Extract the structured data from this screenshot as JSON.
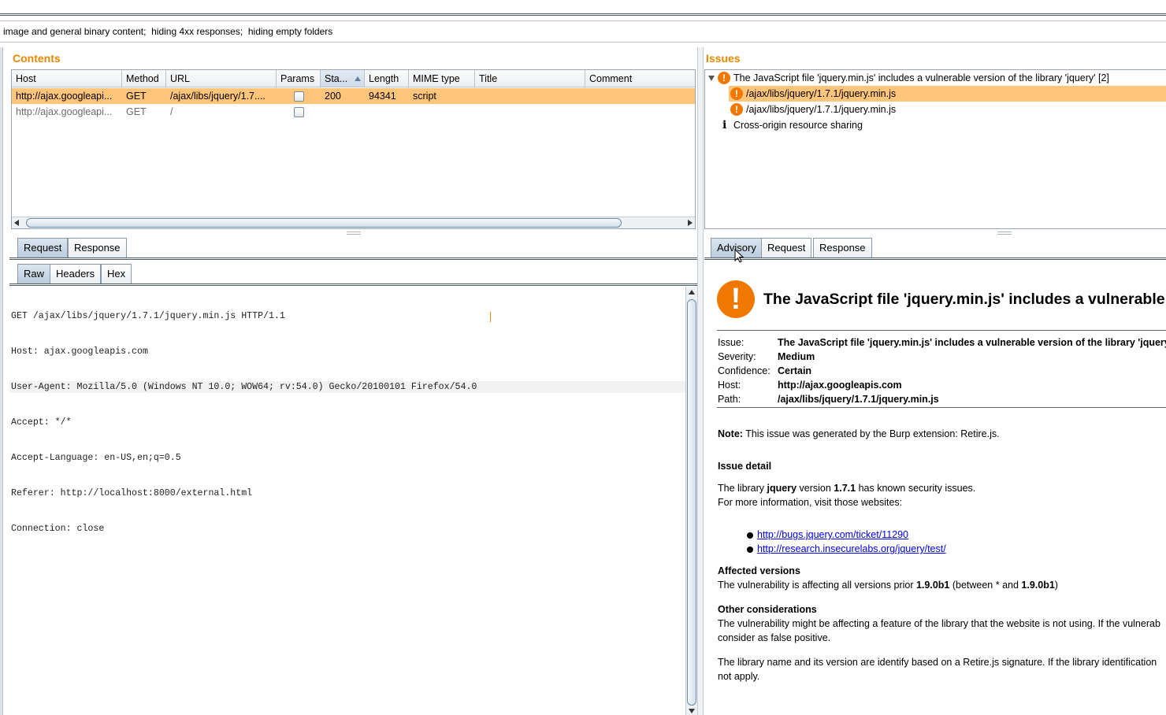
{
  "filter": {
    "text": "image and general binary content;  hiding 4xx responses;  hiding empty folders"
  },
  "contents": {
    "title": "Contents",
    "columns": [
      "Host",
      "Method",
      "URL",
      "Params",
      "Sta...",
      "Length",
      "MIME type",
      "Title",
      "Comment"
    ],
    "rows": [
      {
        "host": "http://ajax.googleapi...",
        "method": "GET",
        "url": "/ajax/libs/jquery/1.7....",
        "status": "200",
        "length": "94341",
        "mime": "script",
        "title": "",
        "comment": ""
      },
      {
        "host": "http://ajax.googleapi...",
        "method": "GET",
        "url": "/",
        "status": "",
        "length": "",
        "mime": "",
        "title": "",
        "comment": ""
      }
    ]
  },
  "leftTabs": {
    "main": [
      "Request",
      "Response"
    ],
    "sub": [
      "Raw",
      "Headers",
      "Hex"
    ]
  },
  "request": {
    "lines": [
      "GET /ajax/libs/jquery/1.7.1/jquery.min.js HTTP/1.1",
      "Host: ajax.googleapis.com",
      "User-Agent: Mozilla/5.0 (Windows NT 10.0; WOW64; rv:54.0) Gecko/20100101 Firefox/54.0",
      "Accept: */*",
      "Accept-Language: en-US,en;q=0.5",
      "Referer: http://localhost:8000/external.html",
      "Connection: close"
    ]
  },
  "issues": {
    "title": "Issues",
    "parent": "The JavaScript file 'jquery.min.js' includes a vulnerable version of the library 'jquery' [2]",
    "children": [
      "/ajax/libs/jquery/1.7.1/jquery.min.js",
      "/ajax/libs/jquery/1.7.1/jquery.min.js"
    ],
    "other": "Cross-origin resource sharing",
    "icon_excl": "!",
    "icon_info": "i"
  },
  "rightTabs": [
    "Advisory",
    "Request",
    "Response"
  ],
  "advisory": {
    "title": "The JavaScript file 'jquery.min.js' includes a vulnerable",
    "fields": [
      {
        "k": "Issue:",
        "v": "The JavaScript file 'jquery.min.js' includes a vulnerable version of the library 'jquery'"
      },
      {
        "k": "Severity:",
        "v": "Medium"
      },
      {
        "k": "Confidence:",
        "v": "Certain"
      },
      {
        "k": "Host:",
        "v": "http://ajax.googleapis.com"
      },
      {
        "k": "Path:",
        "v": "/ajax/libs/jquery/1.7.1/jquery.min.js"
      }
    ],
    "note_label": "Note:",
    "note_text": " This issue was generated by the Burp extension: Retire.js.",
    "detail_heading": "Issue detail",
    "detail_pre": "The library ",
    "detail_lib": "jquery",
    "detail_mid": " version ",
    "detail_ver": "1.7.1",
    "detail_post": " has known security issues.",
    "more_info": "For more information, visit those websites:",
    "links": [
      "http://bugs.jquery.com/ticket/11290",
      "http://research.insecurelabs.org/jquery/test/"
    ],
    "affected_heading": "Affected versions",
    "affected_pre": "The vulnerability is affecting all versions prior ",
    "affected_v1": "1.9.0b1",
    "affected_mid": " (between * and ",
    "affected_v2": "1.9.0b1",
    "affected_post": ")",
    "other_heading": "Other considerations",
    "other_line1": "The vulnerability might be affecting a feature of the library that the website is not using. If the vulnerab",
    "other_line2": "consider as false positive.",
    "other_line3": "The library name and its version are identify based on a Retire.js signature. If the library identification",
    "other_line4": "not apply."
  }
}
